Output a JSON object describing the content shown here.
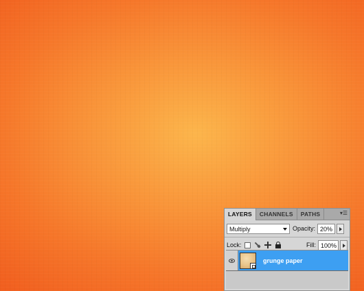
{
  "canvas": {
    "colors": {
      "center": "#fcb54b",
      "edge": "#f15f1f"
    }
  },
  "layers_panel": {
    "tabs": [
      {
        "label": "LAYERS",
        "active": true
      },
      {
        "label": "CHANNELS",
        "active": false
      },
      {
        "label": "PATHS",
        "active": false
      }
    ],
    "panel_menu_icon": "panel-menu-icon",
    "blend_mode": "Multiply",
    "opacity_label": "Opacity:",
    "opacity_value": "20%",
    "lock_label": "Lock:",
    "lock_icons": [
      "lock-transparent-icon",
      "lock-image-icon",
      "lock-position-icon",
      "lock-all-icon"
    ],
    "fill_label": "Fill:",
    "fill_value": "100%",
    "layers": [
      {
        "name": "grunge paper",
        "selected": true,
        "visible": true,
        "smart_object": true
      }
    ],
    "colors": {
      "selection": "#3d9ff2",
      "panel": "#d6d6d6"
    }
  }
}
